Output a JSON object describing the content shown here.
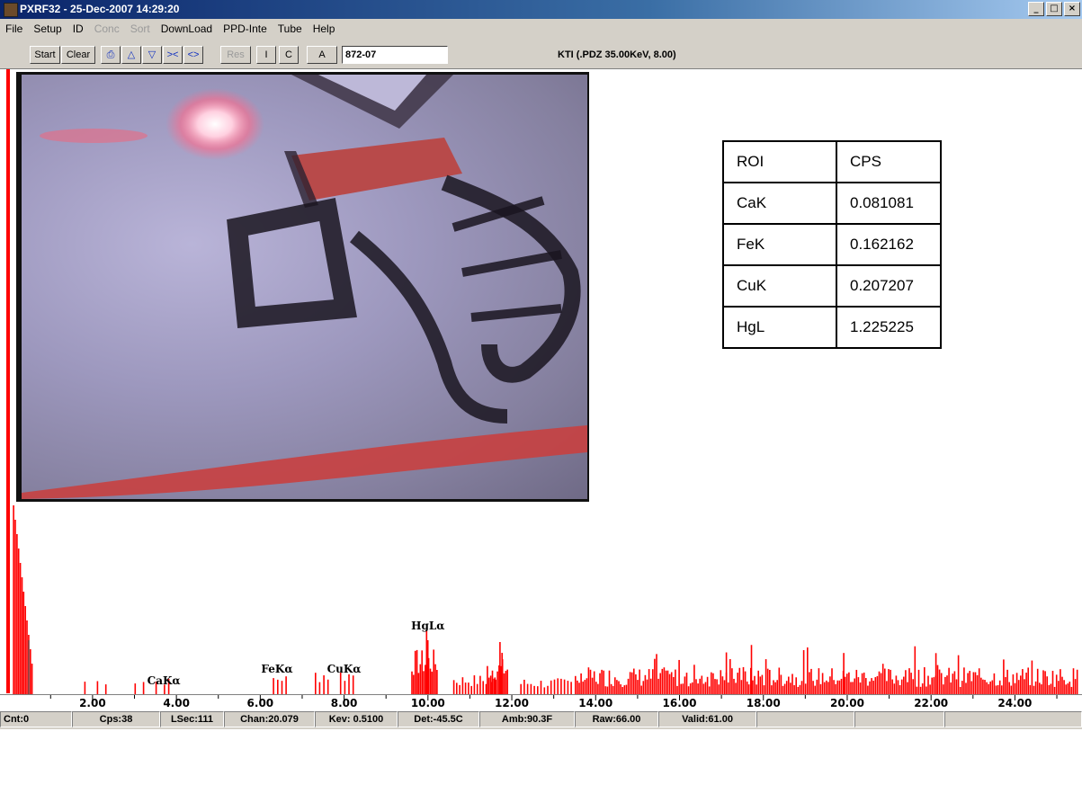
{
  "window": {
    "title": "PXRF32 - 25-Dec-2007 14:29:20",
    "controls": [
      "_",
      "□",
      "×"
    ]
  },
  "menu": [
    {
      "label": "File",
      "enabled": true
    },
    {
      "label": "Setup",
      "enabled": true
    },
    {
      "label": "ID",
      "enabled": true
    },
    {
      "label": "Conc",
      "enabled": false
    },
    {
      "label": "Sort",
      "enabled": false
    },
    {
      "label": "DownLoad",
      "enabled": true
    },
    {
      "label": "PPD-Inte",
      "enabled": true
    },
    {
      "label": "Tube",
      "enabled": true
    },
    {
      "label": "Help",
      "enabled": true
    }
  ],
  "toolbar": {
    "start_label": "Start",
    "clear_label": "Clear",
    "res_label": "Res",
    "i_label": "I",
    "c_label": "C",
    "a_label": "A",
    "sample_id": "872-07",
    "tube_info": "KTI (.PDZ 35.00KeV, 8.00)"
  },
  "roi_table": {
    "headers": [
      "ROI",
      "CPS"
    ],
    "rows": [
      [
        "CaK",
        "0.081081"
      ],
      [
        "FeK",
        "0.162162"
      ],
      [
        "CuK",
        "0.207207"
      ],
      [
        "HgL",
        "1.225225"
      ]
    ]
  },
  "chart_data": {
    "type": "bar",
    "xlabel": "",
    "ylabel": "",
    "x_ticks": [
      "2.00",
      "4.00",
      "6.00",
      "8.00",
      "10.00",
      "12.00",
      "14.00",
      "16.00",
      "18.00",
      "20.00",
      "22.00",
      "24.00"
    ],
    "xlim": [
      0.05,
      25.6
    ],
    "annotations": [
      {
        "text": "CaKα",
        "x": 3.7
      },
      {
        "text": "FeKα",
        "x": 6.4
      },
      {
        "text": "CuKα",
        "x": 8.0
      },
      {
        "text": "HgLα",
        "x": 10.0
      }
    ],
    "series_color": "#ff0000"
  },
  "status": {
    "cnt": "Cnt:0",
    "cps": "Cps:38",
    "lsec": "LSec:111",
    "chan": "Chan:20.079",
    "kev": "Kev: 0.5100",
    "det": "Det:-45.5C",
    "amb": "Amb:90.3F",
    "raw": "Raw:66.00",
    "valid": "Valid:61.00"
  }
}
